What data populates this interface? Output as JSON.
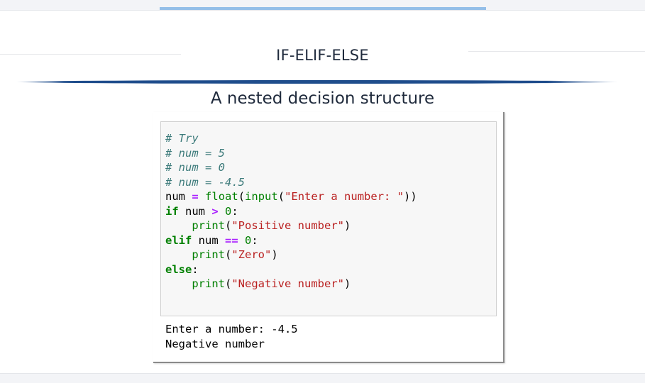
{
  "slide": {
    "title": "IF-ELIF-ELSE",
    "subtitle": "A nested decision structure"
  },
  "notebook": {
    "code_lines": [
      [
        {
          "t": "# Try",
          "k": "comment"
        }
      ],
      [
        {
          "t": "# num = 5",
          "k": "comment"
        }
      ],
      [
        {
          "t": "# num = 0",
          "k": "comment"
        }
      ],
      [
        {
          "t": "# num = -4.5",
          "k": "comment"
        }
      ],
      [
        {
          "t": "num",
          "k": "name"
        },
        {
          "t": " ",
          "k": "ws"
        },
        {
          "t": "=",
          "k": "op"
        },
        {
          "t": " ",
          "k": "ws"
        },
        {
          "t": "float",
          "k": "builtin"
        },
        {
          "t": "(",
          "k": "punc"
        },
        {
          "t": "input",
          "k": "builtin"
        },
        {
          "t": "(",
          "k": "punc"
        },
        {
          "t": "\"Enter a number: \"",
          "k": "str"
        },
        {
          "t": "))",
          "k": "punc"
        }
      ],
      [
        {
          "t": "if",
          "k": "kw"
        },
        {
          "t": " num ",
          "k": "name"
        },
        {
          "t": ">",
          "k": "op"
        },
        {
          "t": " ",
          "k": "ws"
        },
        {
          "t": "0",
          "k": "num"
        },
        {
          "t": ":",
          "k": "punc"
        }
      ],
      [
        {
          "t": "    ",
          "k": "ws"
        },
        {
          "t": "print",
          "k": "builtin"
        },
        {
          "t": "(",
          "k": "punc"
        },
        {
          "t": "\"Positive number\"",
          "k": "str"
        },
        {
          "t": ")",
          "k": "punc"
        }
      ],
      [
        {
          "t": "elif",
          "k": "kw"
        },
        {
          "t": " num ",
          "k": "name"
        },
        {
          "t": "==",
          "k": "op"
        },
        {
          "t": " ",
          "k": "ws"
        },
        {
          "t": "0",
          "k": "num"
        },
        {
          "t": ":",
          "k": "punc"
        }
      ],
      [
        {
          "t": "    ",
          "k": "ws"
        },
        {
          "t": "print",
          "k": "builtin"
        },
        {
          "t": "(",
          "k": "punc"
        },
        {
          "t": "\"Zero\"",
          "k": "str"
        },
        {
          "t": ")",
          "k": "punc"
        }
      ],
      [
        {
          "t": "else",
          "k": "kw"
        },
        {
          "t": ":",
          "k": "punc"
        }
      ],
      [
        {
          "t": "    ",
          "k": "ws"
        },
        {
          "t": "print",
          "k": "builtin"
        },
        {
          "t": "(",
          "k": "punc"
        },
        {
          "t": "\"Negative number\"",
          "k": "str"
        },
        {
          "t": ")",
          "k": "punc"
        }
      ]
    ],
    "output_lines": [
      "Enter a number: -4.5",
      "Negative number"
    ]
  },
  "colors": {
    "divider": "#1f4d8c",
    "top_accent": "#94bfe8",
    "comment": "#3d7b7b",
    "keyword": "#008000",
    "operator": "#aa22ff",
    "string": "#ba2121"
  }
}
